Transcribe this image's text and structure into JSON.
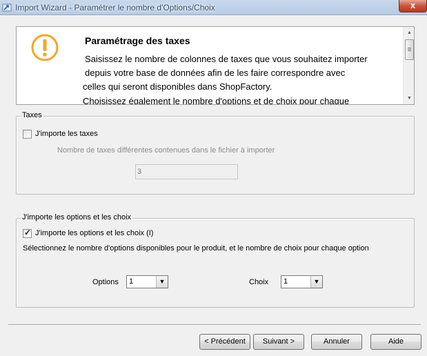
{
  "window": {
    "title": "Import Wizard - Paramétrer le nombre d'Options/Choix",
    "close_glyph": "x"
  },
  "info": {
    "icon": "warning-icon",
    "accent_color": "#f5a623",
    "title": "Paramétrage des taxes",
    "line1": "Saisissez le nombre de colonnes de taxes que vous souhaitez importer",
    "line2": "depuis votre base de données afin de les faire correspondre avec",
    "line3": "celles qui seront disponibles dans ShopFactory.",
    "line4": "Choisissez également le nombre d'options et de choix pour chaque"
  },
  "taxes": {
    "legend": "Taxes",
    "checkbox_label": "J'importe les taxes",
    "checked": false,
    "count_label": "Nombre de taxes différentes contenues dans le fichier à importer",
    "count_value": "3"
  },
  "options": {
    "legend": "J'importe les options et les choix",
    "checkbox_label": "J'importe les options et les choix  (I)",
    "checked": true,
    "description": "Sélectionnez le nombre d'options disponibles pour le produit, et le nombre de choix pour chaque option",
    "options_label": "Options",
    "options_value": "1",
    "choices_label": "Choix",
    "choices_value": "1"
  },
  "buttons": {
    "previous": "< Précédent",
    "next": "Suivant >",
    "cancel": "Annuler",
    "help": "Aide"
  }
}
